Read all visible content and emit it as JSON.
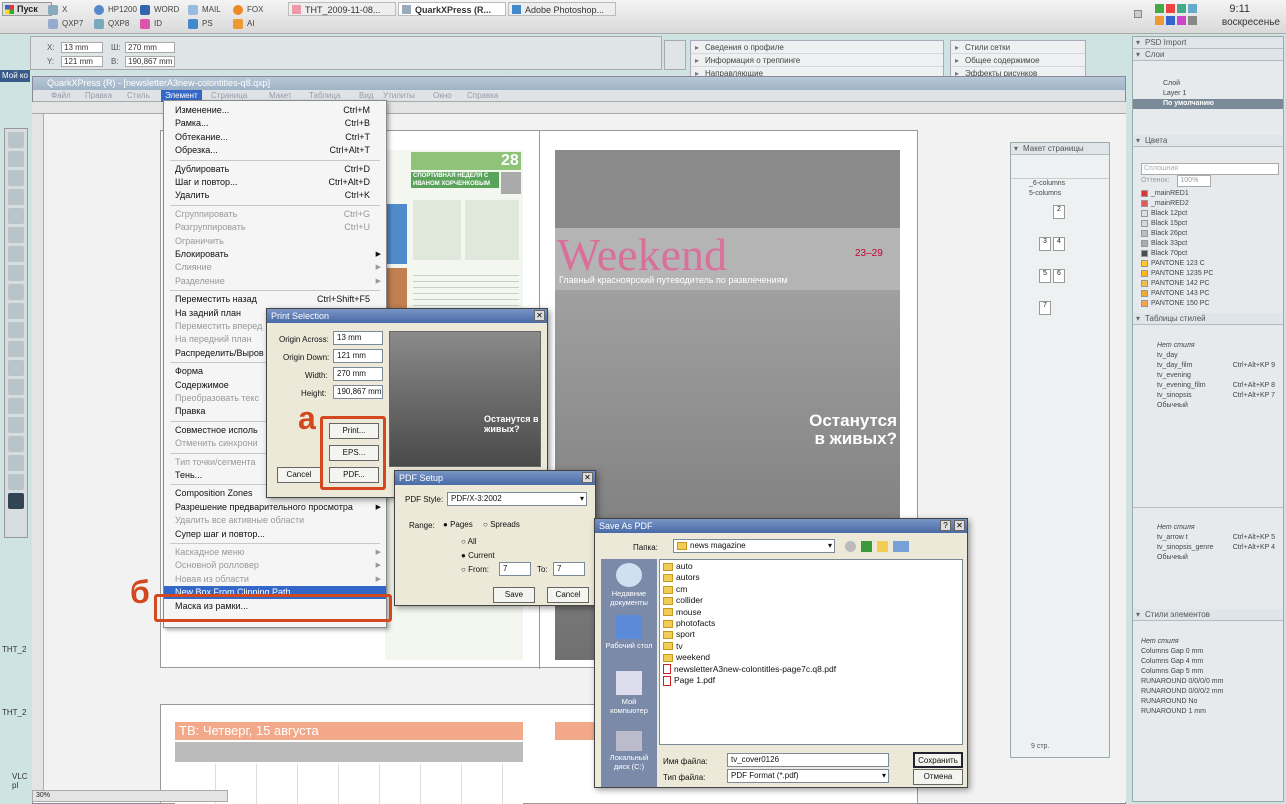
{
  "taskbar": {
    "start_label": "Пуск",
    "quick_launch": [
      "X",
      "HP1200",
      "WORD",
      "MAIL",
      "FOX",
      "QXP7",
      "QXP8",
      "ID",
      "PS",
      "AI"
    ],
    "tasks": [
      "THT_2009-11-08...",
      "QuarkXPress (R...",
      "Adobe Photoshop..."
    ],
    "clock_time": "9:11",
    "clock_day": "воскресенье"
  },
  "desktop": {
    "my_computer_label": "Мой ко",
    "side_labels": [
      "THT_2",
      "THT_2",
      "VLC pl"
    ]
  },
  "measurements": {
    "x_label": "X:",
    "x_value": "13 mm",
    "y_label": "Y:",
    "y_value": "121 mm",
    "w_label": "Ш:",
    "w_value": "270 mm",
    "h_label": "В:",
    "h_value": "190,867 mm"
  },
  "floating_palettes": {
    "profile": [
      "Сведения о профиле",
      "Информация о треппинге",
      "Направляющие"
    ],
    "grid": [
      "Стили сетки",
      "Общее содержимое",
      "Эффекты рисунков"
    ]
  },
  "app": {
    "title": "QuarkXPress (R) - [newsletterA3new-colontitles-q8.qxp]",
    "menus": [
      "Файл",
      "Правка",
      "Стиль",
      "Элемент",
      "Страница",
      "Макет",
      "Таблица",
      "Вид",
      "Утилиты",
      "Окно",
      "Справка"
    ]
  },
  "element_menu": {
    "items": [
      {
        "label": "Изменение...",
        "shortcut": "Ctrl+M",
        "disabled": false
      },
      {
        "label": "Рамка...",
        "shortcut": "Ctrl+B",
        "disabled": false
      },
      {
        "label": "Обтекание...",
        "shortcut": "Ctrl+T",
        "disabled": false
      },
      {
        "label": "Обрезка...",
        "shortcut": "Ctrl+Alt+T",
        "disabled": false
      },
      {
        "label": "Дублировать",
        "shortcut": "Ctrl+D",
        "disabled": false
      },
      {
        "label": "Шаг и повтор...",
        "shortcut": "Ctrl+Alt+D",
        "disabled": false
      },
      {
        "label": "Удалить",
        "shortcut": "Ctrl+K",
        "disabled": false
      },
      {
        "label": "Сгруппировать",
        "shortcut": "Ctrl+G",
        "disabled": true
      },
      {
        "label": "Разгруппировать",
        "shortcut": "Ctrl+U",
        "disabled": true
      },
      {
        "label": "Ограничить",
        "shortcut": "",
        "disabled": true
      },
      {
        "label": "Блокировать",
        "shortcut": "",
        "disabled": false
      },
      {
        "label": "Слияние",
        "shortcut": "",
        "disabled": true
      },
      {
        "label": "Разделение",
        "shortcut": "",
        "disabled": true
      },
      {
        "label": "Переместить назад",
        "shortcut": "Ctrl+Shift+F5",
        "disabled": false
      },
      {
        "label": "На задний план",
        "shortcut": "Shift+F5",
        "disabled": false
      },
      {
        "label": "Переместить вперед",
        "shortcut": "",
        "disabled": true
      },
      {
        "label": "На передний план",
        "shortcut": "",
        "disabled": true
      },
      {
        "label": "Распределить/Выров",
        "shortcut": "",
        "disabled": false
      },
      {
        "label": "Форма",
        "shortcut": "",
        "disabled": false
      },
      {
        "label": "Содержимое",
        "shortcut": "",
        "disabled": false
      },
      {
        "label": "Преобразовать текс",
        "shortcut": "",
        "disabled": true
      },
      {
        "label": "Правка",
        "shortcut": "",
        "disabled": false
      },
      {
        "label": "Совместное исполь",
        "shortcut": "",
        "disabled": false
      },
      {
        "label": "Отменить синхрони",
        "shortcut": "",
        "disabled": true
      },
      {
        "label": "Тип точки/сегмента",
        "shortcut": "",
        "disabled": true
      },
      {
        "label": "Тень...",
        "shortcut": "",
        "disabled": false
      },
      {
        "label": "Composition Zones",
        "shortcut": "",
        "disabled": false
      },
      {
        "label": "Разрешение предварительного просмотра",
        "shortcut": "",
        "disabled": false
      },
      {
        "label": "Удалить все активные области",
        "shortcut": "",
        "disabled": true
      },
      {
        "label": "Супер шаг и повтор...",
        "shortcut": "",
        "disabled": false
      },
      {
        "label": "Каскадное меню",
        "shortcut": "",
        "disabled": true
      },
      {
        "label": "Основной ролловер",
        "shortcut": "",
        "disabled": true
      },
      {
        "label": "Новая из области",
        "shortcut": "",
        "disabled": true
      },
      {
        "label": "New Box From Clipping Path",
        "shortcut": "",
        "disabled": false
      },
      {
        "label": "Маска из рамки...",
        "shortcut": "",
        "disabled": false
      }
    ]
  },
  "print_selection": {
    "title": "Print Selection",
    "origin_across_label": "Origin Across:",
    "origin_across_value": "13 mm",
    "origin_down_label": "Origin Down:",
    "origin_down_value": "121 mm",
    "width_label": "Width:",
    "width_value": "270 mm",
    "height_label": "Height:",
    "height_value": "190,867 mm",
    "print_btn": "Print...",
    "eps_btn": "EPS...",
    "pdf_btn": "PDF...",
    "cancel_btn": "Cancel"
  },
  "pdf_setup": {
    "title": "PDF Setup",
    "style_label": "PDF Style:",
    "style_value": "PDF/X-3:2002",
    "range_label": "Range:",
    "pages_label": "Pages",
    "spreads_label": "Spreads",
    "all_label": "All",
    "current_label": "Current",
    "from_label": "From:",
    "from_value": "7",
    "to_label": "To:",
    "to_value": "7",
    "save_btn": "Save",
    "cancel_btn": "Cancel"
  },
  "save_as_pdf": {
    "title": "Save As PDF",
    "folder_label": "Папка:",
    "folder_value": "news magazine",
    "places": [
      "Недавние документы",
      "Рабочий стол",
      "Мой компьютер",
      "Локальный диск (C:)"
    ],
    "files": [
      {
        "name": "auto",
        "type": "folder"
      },
      {
        "name": "autors",
        "type": "folder"
      },
      {
        "name": "cm",
        "type": "folder"
      },
      {
        "name": "collider",
        "type": "folder"
      },
      {
        "name": "mouse",
        "type": "folder"
      },
      {
        "name": "photofacts",
        "type": "folder"
      },
      {
        "name": "sport",
        "type": "folder"
      },
      {
        "name": "tv",
        "type": "folder"
      },
      {
        "name": "weekend",
        "type": "folder"
      },
      {
        "name": "newsletterA3new-colontitles-page7c.q8.pdf",
        "type": "pdf"
      },
      {
        "name": "Page 1.pdf",
        "type": "pdf"
      }
    ],
    "filename_label": "Имя файла:",
    "filename_value": "tv_cover0126",
    "filetype_label": "Тип файла:",
    "filetype_value": "PDF Format (*.pdf)",
    "save_btn": "Сохранить",
    "cancel_btn": "Отмена"
  },
  "page_layout_panel": {
    "title": "Макет страницы",
    "masters": [
      "_6-columns",
      "5-columns"
    ],
    "pages_label": "9 стр.",
    "page_numbers": [
      "2",
      "3",
      "4",
      "5",
      "6",
      "7"
    ]
  },
  "right_panels": {
    "psd_import": "PSD Import",
    "layers_title": "Слои",
    "layers_header": "Слой",
    "layers": [
      "Layer 1",
      "По умолчанию"
    ],
    "colors_title": "Цвета",
    "color_fill_label": "Сплошная",
    "color_opacity_label": "Оттенок:",
    "color_pct_value": "100%",
    "colors": [
      {
        "name": "_mainRED1",
        "hex": "#d23a3a"
      },
      {
        "name": "_mainRED2",
        "hex": "#e05b5b"
      },
      {
        "name": "Black 12pct",
        "hex": "#e0e0e0"
      },
      {
        "name": "Black 15pct",
        "hex": "#d9d9d9"
      },
      {
        "name": "Black 26pct",
        "hex": "#bdbdbd"
      },
      {
        "name": "Black 33pct",
        "hex": "#ababab"
      },
      {
        "name": "Black 70pct",
        "hex": "#4d4d4d"
      },
      {
        "name": "PANTONE 123 C",
        "hex": "#ffc72c"
      },
      {
        "name": "PANTONE 1235 PC",
        "hex": "#ffb81c"
      },
      {
        "name": "PANTONE 142 PC",
        "hex": "#f1be48"
      },
      {
        "name": "PANTONE 143 PC",
        "hex": "#eda934"
      },
      {
        "name": "PANTONE 150 PC",
        "hex": "#f7a24b"
      }
    ],
    "styles_title": "Таблицы стилей",
    "para_styles": [
      {
        "name": "Нет стиля",
        "shortcut": ""
      },
      {
        "name": "tv_day",
        "shortcut": ""
      },
      {
        "name": "tv_day_film",
        "shortcut": "Ctrl+Alt+KP 9"
      },
      {
        "name": "tv_evening",
        "shortcut": ""
      },
      {
        "name": "tv_evening_film",
        "shortcut": "Ctrl+Alt+KP 8"
      },
      {
        "name": "tv_sinopsis",
        "shortcut": "Ctrl+Alt+KP 7"
      },
      {
        "name": "Обычный",
        "shortcut": ""
      }
    ],
    "char_styles": [
      {
        "name": "Нет стиля",
        "shortcut": ""
      },
      {
        "name": "tv_arrow t",
        "shortcut": "Ctrl+Alt+KP 5"
      },
      {
        "name": "tv_sinopsis_genre",
        "shortcut": "Ctrl+Alt+KP 4"
      },
      {
        "name": "Обычный",
        "shortcut": ""
      }
    ],
    "item_styles_title": "Стили элементов",
    "item_styles": [
      "Нет стиля",
      "Columns Gap 0 mm",
      "Columns Gap 4 mm",
      "Columns Gap 5 mm",
      "RUNAROUND 0/0/0/0 mm",
      "RUNAROUND 0/0/0/2 mm",
      "RUNAROUND No",
      "RUNAROUND 1 mm"
    ]
  },
  "document": {
    "weekend_title": "Weekend",
    "weekend_subtitle": "Главный красноярский путеводитель по развлечениям",
    "cover_headline": "Останутся в живых?",
    "sport_header": "СПОРТИВНАЯ НЕДЕЛЯ С ИВАНОМ ХОРЧЕНКОВЫМ",
    "page_num": "28",
    "date_badge": "23–29",
    "tv_header": "ТВ: Четверг, 15 августа",
    "zoom_value": "30%"
  },
  "annotations": {
    "a": "а",
    "b": "б"
  },
  "colors": {
    "accent": "#d3481f",
    "menu_highlight": "#3468c8",
    "weekend_pink": "#d9709a"
  }
}
